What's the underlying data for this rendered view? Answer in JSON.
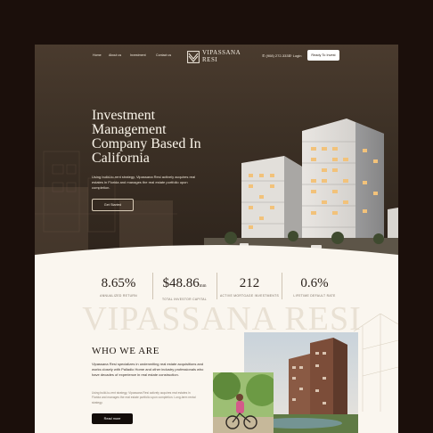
{
  "nav": {
    "links": [
      "Home",
      "About us",
      "Investment",
      "Contact us"
    ],
    "logo_line1": "VIPASSANA",
    "logo_line2": "RESI",
    "phone": "(908) 272-3333",
    "login": "Login",
    "cta": "Ready To Invest"
  },
  "hero": {
    "title": "Investment Management Company Based In California",
    "description": "Using build-to-rent strategy, Vipassana Resi actively acquires real estates in Florida and manages the real estate portfolio upon completion.",
    "button": "Get Started"
  },
  "stats": [
    {
      "value": "8.65%",
      "unit": "",
      "label": "ANNUALIZED RETURN"
    },
    {
      "value": "$48.86",
      "unit": "mm",
      "label": "TOTAL INVESTOR CAPITAL"
    },
    {
      "value": "212",
      "unit": "",
      "label": "ACTIVE MORTGAGE INVESTMENTS"
    },
    {
      "value": "0.6%",
      "unit": "",
      "label": "LIFETIME DEFAULT RATE"
    }
  ],
  "watermark": "VIPASSANA RESI",
  "who": {
    "title": "WHO WE ARE",
    "paragraph1": "Vipassana Resi specializes in underwriting real estate acquisitions and works closely with Palladio Home and other industry professionals who have decades of experience in real estate construction.",
    "paragraph2": "Using build-to-rent strategy, Vipassana Resi actively acquires real estates in Florida and manages the real estate portfolio upon completion. Long-term rental strategy.",
    "button": "Read more"
  },
  "colors": {
    "hero_bg": "#3d3126",
    "page_bg": "#faf6ef",
    "outer_bg": "#1b0f0b",
    "accent_dark": "#120c09"
  }
}
